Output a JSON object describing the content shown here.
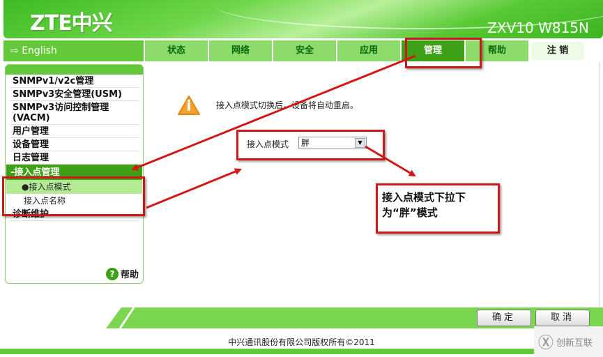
{
  "header": {
    "logo": "ZTE中兴",
    "model": "ZXV10 W815N"
  },
  "nav": {
    "language": "English",
    "tabs": [
      {
        "label": "状态",
        "active": false
      },
      {
        "label": "网络",
        "active": false
      },
      {
        "label": "安全",
        "active": false
      },
      {
        "label": "应用",
        "active": false
      },
      {
        "label": "管理",
        "active": true
      },
      {
        "label": "帮助",
        "active": false
      }
    ],
    "logout": "注 销"
  },
  "sidebar": {
    "items": [
      {
        "label": "SNMPv1/v2c管理"
      },
      {
        "label": "SNMPv3安全管理(USM)"
      },
      {
        "label": "SNMPv3访问控制管理(VACM)"
      },
      {
        "label": "用户管理"
      },
      {
        "label": "设备管理"
      },
      {
        "label": "日志管理"
      },
      {
        "label": "-接入点管理",
        "expanded": true,
        "children": [
          {
            "label": "●接入点模式",
            "selected": true
          },
          {
            "label": "接入点名称",
            "selected": false
          }
        ]
      },
      {
        "label": "诊断维护"
      }
    ],
    "help": "帮助",
    "help_icon": "question-icon"
  },
  "main": {
    "warning_icon": "warning-icon",
    "warning_text": "接入点模式切换后，设备将自动重启。",
    "field_label": "接入点模式",
    "select_value": "胖"
  },
  "annotation": {
    "note": "接入点模式下拉下为“胖”模式",
    "color": "#d01818"
  },
  "footer": {
    "ok": "确定",
    "cancel": "取消",
    "copyright": "中兴通讯股份有限公司版权所有©2011",
    "watermark": "创新互联"
  }
}
